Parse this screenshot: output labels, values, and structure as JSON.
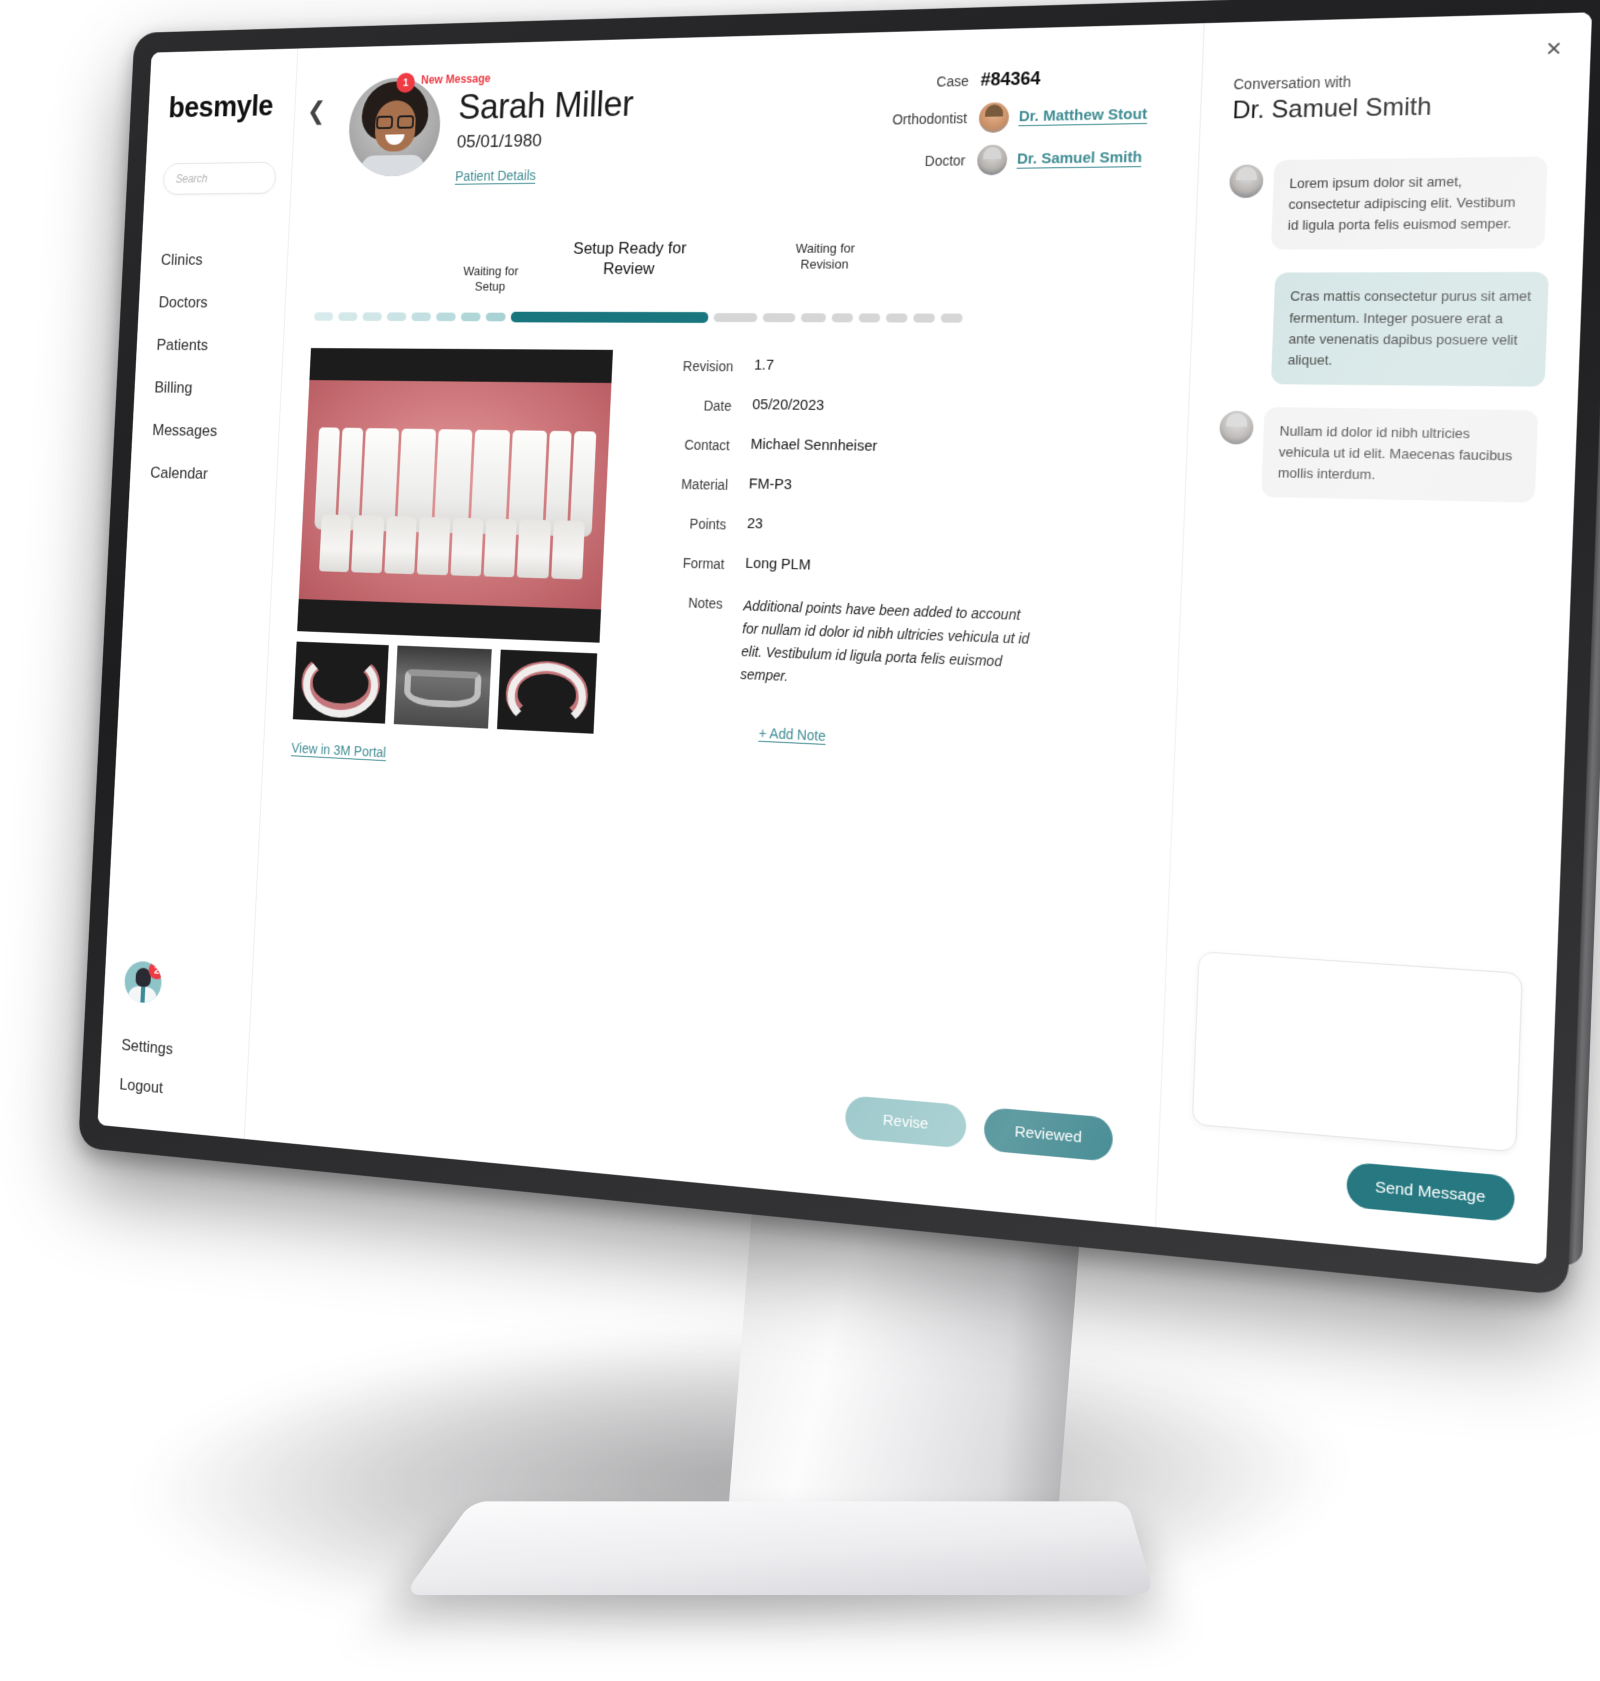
{
  "sidebar": {
    "logo": "besmyle",
    "search_placeholder": "Search",
    "items": [
      {
        "label": "Clinics"
      },
      {
        "label": "Doctors"
      },
      {
        "label": "Patients"
      },
      {
        "label": "Billing"
      },
      {
        "label": "Messages"
      },
      {
        "label": "Calendar"
      }
    ],
    "avatar_badge": "2",
    "settings_label": "Settings",
    "logout_label": "Logout"
  },
  "patient": {
    "name": "Sarah Miller",
    "dob": "05/01/1980",
    "details_link": "Patient Details",
    "badge_count": "1",
    "new_message_label": "New Message"
  },
  "case": {
    "case_label": "Case",
    "case_number": "#84364",
    "orthodontist_label": "Orthodontist",
    "orthodontist_name": "Dr. Matthew Stout",
    "doctor_label": "Doctor",
    "doctor_name": "Dr. Samuel Smith"
  },
  "progress": {
    "steps": [
      {
        "label": "Waiting for\nSetup",
        "state": "done"
      },
      {
        "label": "Setup Ready for\nReview",
        "state": "active"
      },
      {
        "label": "Waiting for\nRevision",
        "state": "pending"
      }
    ],
    "active_color": "#19757e",
    "done_color": "#a9d2d4",
    "pending_color": "#d6d6d6"
  },
  "media": {
    "view_portal_link": "View in 3M Portal",
    "thumbnails": [
      "lower-arch-scan",
      "panoramic-xray",
      "upper-arch-scan"
    ]
  },
  "details": {
    "rows": [
      {
        "label": "Revision",
        "value": "1.7"
      },
      {
        "label": "Date",
        "value": "05/20/2023"
      },
      {
        "label": "Contact",
        "value": "Michael Sennheiser"
      },
      {
        "label": "Material",
        "value": "FM-P3"
      },
      {
        "label": "Points",
        "value": "23"
      },
      {
        "label": "Format",
        "value": "Long PLM"
      }
    ],
    "notes_label": "Notes",
    "notes_value": "Additional points have been added to account for nullam id dolor id nibh ultricies vehicula ut id elit. Vestibulum id ligula porta felis euismod semper.",
    "add_note_label": "+ Add Note"
  },
  "actions": {
    "revise_label": "Revise",
    "reviewed_label": "Reviewed",
    "revise_color": "#8bbfc2",
    "reviewed_color": "#1b717a"
  },
  "conversation": {
    "close_icon": "×",
    "subtitle": "Conversation with",
    "title": "Dr. Samuel Smith",
    "messages": [
      {
        "from": "them",
        "text": "Lorem ipsum dolor sit amet, consectetur adipiscing elit. Vestibum id ligula porta felis euismod semper."
      },
      {
        "from": "me",
        "text": "Cras mattis consectetur purus sit amet fermentum. Integer posuere erat a ante venenatis dapibus posuere velit aliquet."
      },
      {
        "from": "them",
        "text": "Nullam id dolor id nibh ultricies vehicula ut id elit. Maecenas faucibus mollis interdum."
      }
    ],
    "compose_value": "",
    "send_label": "Send Message"
  }
}
